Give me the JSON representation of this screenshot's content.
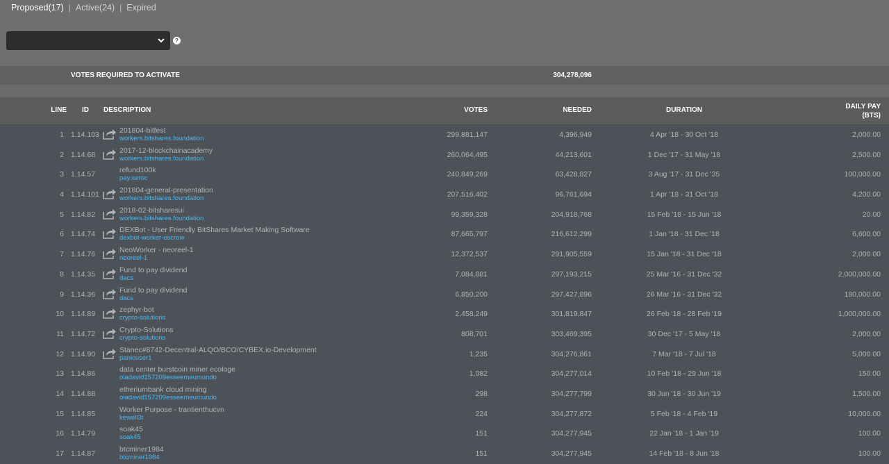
{
  "tabs": [
    {
      "label": "Proposed(17)",
      "active": true
    },
    {
      "label": "Active(24)",
      "active": false
    },
    {
      "label": "Expired",
      "active": false
    }
  ],
  "tab_separator": "|",
  "filter_select": {
    "value": ""
  },
  "help_icon": "?",
  "votes_required": {
    "label": "VOTES REQUIRED TO ACTIVATE",
    "value": "304,278,096"
  },
  "columns": {
    "line": "LINE",
    "id": "ID",
    "description": "DESCRIPTION",
    "votes": "VOTES",
    "needed": "NEEDED",
    "duration": "DURATION",
    "daily_pay": "DAILY PAY",
    "daily_pay_unit": "(BTS)"
  },
  "rows": [
    {
      "line": "1",
      "id": "1.14.103",
      "name": "201804-bitfest",
      "account": "workers.bitshares.foundation",
      "votes": "299,881,147",
      "needed": "4,396,949",
      "duration": "4 Apr '18 - 30 Oct '18",
      "daily": "2,000.00",
      "icon": true
    },
    {
      "line": "2",
      "id": "1.14.68",
      "name": "2017-12-blockchainacademy",
      "account": "workers.bitshares.foundation",
      "votes": "260,064,495",
      "needed": "44,213,601",
      "duration": "1 Dec '17 - 31 May '18",
      "daily": "2,500.00",
      "icon": true
    },
    {
      "line": "3",
      "id": "1.14.57",
      "name": "refund100k",
      "account": "pay.xeroc",
      "votes": "240,849,269",
      "needed": "63,428,827",
      "duration": "3 Aug '17 - 31 Dec '35",
      "daily": "100,000.00",
      "icon": false
    },
    {
      "line": "4",
      "id": "1.14.101",
      "name": "201804-general-presentation",
      "account": "workers.bitshares.foundation",
      "votes": "207,516,402",
      "needed": "96,761,694",
      "duration": "1 Apr '18 - 31 Oct '18",
      "daily": "4,200.00",
      "icon": true
    },
    {
      "line": "5",
      "id": "1.14.82",
      "name": "2018-02-bitsharesui",
      "account": "workers.bitshares.foundation",
      "votes": "99,359,328",
      "needed": "204,918,768",
      "duration": "15 Feb '18 - 15 Jun '18",
      "daily": "20.00",
      "icon": true
    },
    {
      "line": "6",
      "id": "1.14.74",
      "name": "DEXBot - User Friendly BitShares Market Making Software",
      "account": "dexbot-worker-escrow",
      "votes": "87,665,797",
      "needed": "216,612,299",
      "duration": "1 Jan '18 - 31 Dec '18",
      "daily": "6,600.00",
      "icon": true
    },
    {
      "line": "7",
      "id": "1.14.76",
      "name": "NeoWorker - neoreel-1",
      "account": "neoreel-1",
      "votes": "12,372,537",
      "needed": "291,905,559",
      "duration": "15 Jan '18 - 31 Dec '18",
      "daily": "2,000.00",
      "icon": true
    },
    {
      "line": "8",
      "id": "1.14.35",
      "name": "Fund to pay dividend",
      "account": "dacs",
      "votes": "7,084,881",
      "needed": "297,193,215",
      "duration": "25 Mar '16 - 31 Dec '32",
      "daily": "2,000,000.00",
      "icon": true
    },
    {
      "line": "9",
      "id": "1.14.36",
      "name": "Fund to pay dividend",
      "account": "dacs",
      "votes": "6,850,200",
      "needed": "297,427,896",
      "duration": "26 Mar '16 - 31 Dec '32",
      "daily": "180,000.00",
      "icon": true
    },
    {
      "line": "10",
      "id": "1.14.89",
      "name": "zephyr-bot",
      "account": "crypto-solutions",
      "votes": "2,458,249",
      "needed": "301,819,847",
      "duration": "26 Feb '18 - 28 Feb '19",
      "daily": "1,000,000.00",
      "icon": true
    },
    {
      "line": "11",
      "id": "1.14.72",
      "name": "Crypto-Solutions",
      "account": "crypto-solutions",
      "votes": "808,701",
      "needed": "303,469,395",
      "duration": "30 Dec '17 - 5 May '18",
      "daily": "2,000.00",
      "icon": true
    },
    {
      "line": "12",
      "id": "1.14.90",
      "name": "Stanec#8742-Decentral-ALQO/BCO/CYBEX.io-Development",
      "account": "panicuser1",
      "votes": "1,235",
      "needed": "304,276,861",
      "duration": "7 Mar '18 - 7 Jul '18",
      "daily": "5,000.00",
      "icon": true
    },
    {
      "line": "13",
      "id": "1.14.86",
      "name": "data center burstcoin miner ecologe",
      "account": "oladavid157209esseemeumundo",
      "votes": "1,082",
      "needed": "304,277,014",
      "duration": "10 Feb '18 - 29 Jun '18",
      "daily": "150.00",
      "icon": false
    },
    {
      "line": "14",
      "id": "1.14.88",
      "name": "etheriumbank cloud mining",
      "account": "oladavid157209esseemeumundo",
      "votes": "298",
      "needed": "304,277,799",
      "duration": "30 Jun '18 - 30 Jun '19",
      "daily": "1,500.00",
      "icon": false
    },
    {
      "line": "15",
      "id": "1.14.85",
      "name": "Worker Purpose - trantienthucvn",
      "account": "kewell3t",
      "votes": "224",
      "needed": "304,277,872",
      "duration": "5 Feb '18 - 4 Feb '19",
      "daily": "10,000.00",
      "icon": false
    },
    {
      "line": "16",
      "id": "1.14.79",
      "name": "soak45",
      "account": "soak45",
      "votes": "151",
      "needed": "304,277,945",
      "duration": "22 Jan '18 - 1 Jan '19",
      "daily": "100.00",
      "icon": false
    },
    {
      "line": "17",
      "id": "1.14.87",
      "name": "btcminer1984",
      "account": "btcminer1984",
      "votes": "151",
      "needed": "304,277,945",
      "duration": "14 Feb '18 - 8 Jun '18",
      "daily": "100.00",
      "icon": false
    }
  ]
}
